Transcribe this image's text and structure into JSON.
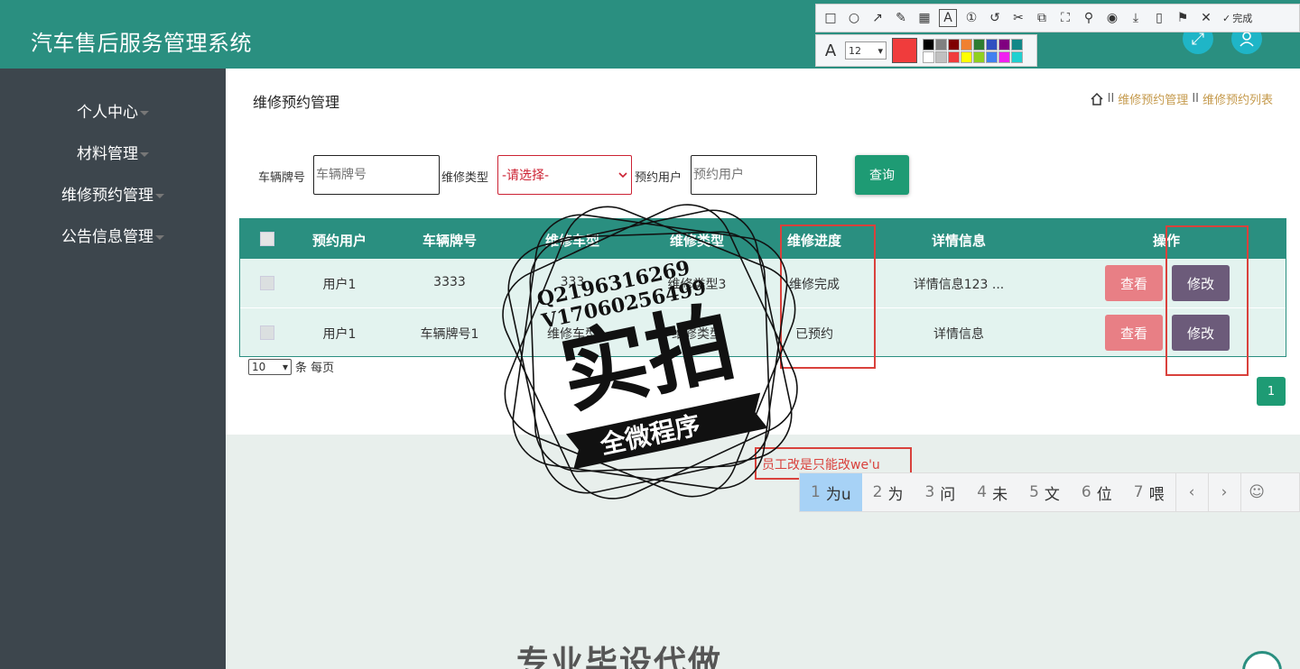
{
  "header": {
    "app_title": "汽车售后服务管理系统"
  },
  "sidebar": {
    "items": [
      {
        "label": "个人中心"
      },
      {
        "label": "材料管理"
      },
      {
        "label": "维修预约管理"
      },
      {
        "label": "公告信息管理"
      }
    ]
  },
  "page": {
    "title": "维修预约管理"
  },
  "breadcrumb": {
    "sep": "II",
    "level1": "维修预约管理",
    "level2": "维修预约列表"
  },
  "search": {
    "plate_label": "车辆牌号",
    "plate_placeholder": "车辆牌号",
    "type_label": "维修类型",
    "type_selected": "-请选择-",
    "user_label": "预约用户",
    "user_placeholder": "预约用户",
    "button": "查询"
  },
  "table": {
    "headers": [
      "预约用户",
      "车辆牌号",
      "维修车型",
      "维修类型",
      "维修进度",
      "详情信息",
      "操作"
    ],
    "rows": [
      {
        "user": "用户1",
        "plate": "3333",
        "model": "333",
        "type": "维修类型3",
        "progress": "维修完成",
        "detail": "详情信息123 ..."
      },
      {
        "user": "用户1",
        "plate": "车辆牌号1",
        "model": "维修车型",
        "type": "维修类型",
        "progress": "已预约",
        "detail": "详情信息"
      }
    ],
    "view_label": "查看",
    "edit_label": "修改"
  },
  "pager": {
    "page_size": "10",
    "suffix": "条 每页",
    "current_page": "1"
  },
  "annotation": {
    "note": "员工改是只能改we'u"
  },
  "ime": {
    "candidates": [
      {
        "n": "1",
        "t": "为u"
      },
      {
        "n": "2",
        "t": "为"
      },
      {
        "n": "3",
        "t": "问"
      },
      {
        "n": "4",
        "t": "未"
      },
      {
        "n": "5",
        "t": "文"
      },
      {
        "n": "6",
        "t": "位"
      },
      {
        "n": "7",
        "t": "喂"
      }
    ]
  },
  "toolbar": {
    "done_label": "完成",
    "font_size": "12",
    "current_color": "#f03c3c",
    "palette": [
      "#000000",
      "#808080",
      "#800000",
      "#f08030",
      "#2e7d32",
      "#3050c0",
      "#800080",
      "#108888",
      "#ffffff",
      "#c0c0c0",
      "#f03c3c",
      "#ffff00",
      "#90d020",
      "#4080f0",
      "#f020f0",
      "#20d0d0"
    ]
  },
  "watermark": {
    "line1": "Q2196316269",
    "line2": "V17060256499",
    "big": "实拍",
    "banner": "全微程序"
  },
  "bottom": {
    "text": "专业毕设代做"
  }
}
